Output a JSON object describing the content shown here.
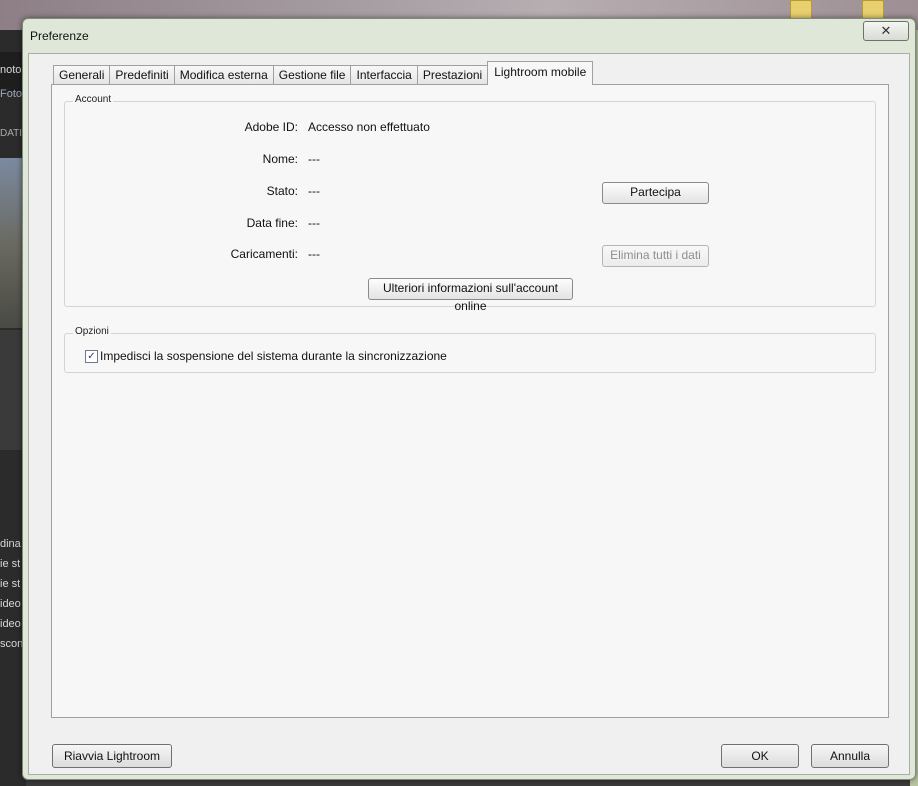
{
  "background": {
    "left_texts": [
      "noto",
      "Foto",
      "DATI",
      "dina",
      "ie st",
      "ie st",
      "ideo",
      "ideo",
      "scon"
    ]
  },
  "window": {
    "title": "Preferenze",
    "close_glyph": "✕"
  },
  "tabs": [
    {
      "label": "Generali",
      "active": false
    },
    {
      "label": "Predefiniti",
      "active": false
    },
    {
      "label": "Modifica esterna",
      "active": false
    },
    {
      "label": "Gestione file",
      "active": false
    },
    {
      "label": "Interfaccia",
      "active": false
    },
    {
      "label": "Prestazioni",
      "active": false
    },
    {
      "label": "Lightroom mobile",
      "active": true
    }
  ],
  "account": {
    "legend": "Account",
    "adobe_id_label": "Adobe ID:",
    "adobe_id_value": "Accesso non effettuato",
    "name_label": "Nome:",
    "name_value": "---",
    "status_label": "Stato:",
    "status_value": "---",
    "end_date_label": "Data fine:",
    "end_date_value": "---",
    "uploads_label": "Caricamenti:",
    "uploads_value": "---",
    "join_button": "Partecipa",
    "delete_all_button": "Elimina tutti i dati",
    "more_info_button": "Ulteriori informazioni sull'account online"
  },
  "options": {
    "legend": "Opzioni",
    "prevent_sleep_label": "Impedisci la sospensione del sistema durante la sincronizzazione",
    "prevent_sleep_checked": true,
    "check_glyph": "✓"
  },
  "footer": {
    "restart_button": "Riavvia Lightroom",
    "ok_button": "OK",
    "cancel_button": "Annulla"
  }
}
